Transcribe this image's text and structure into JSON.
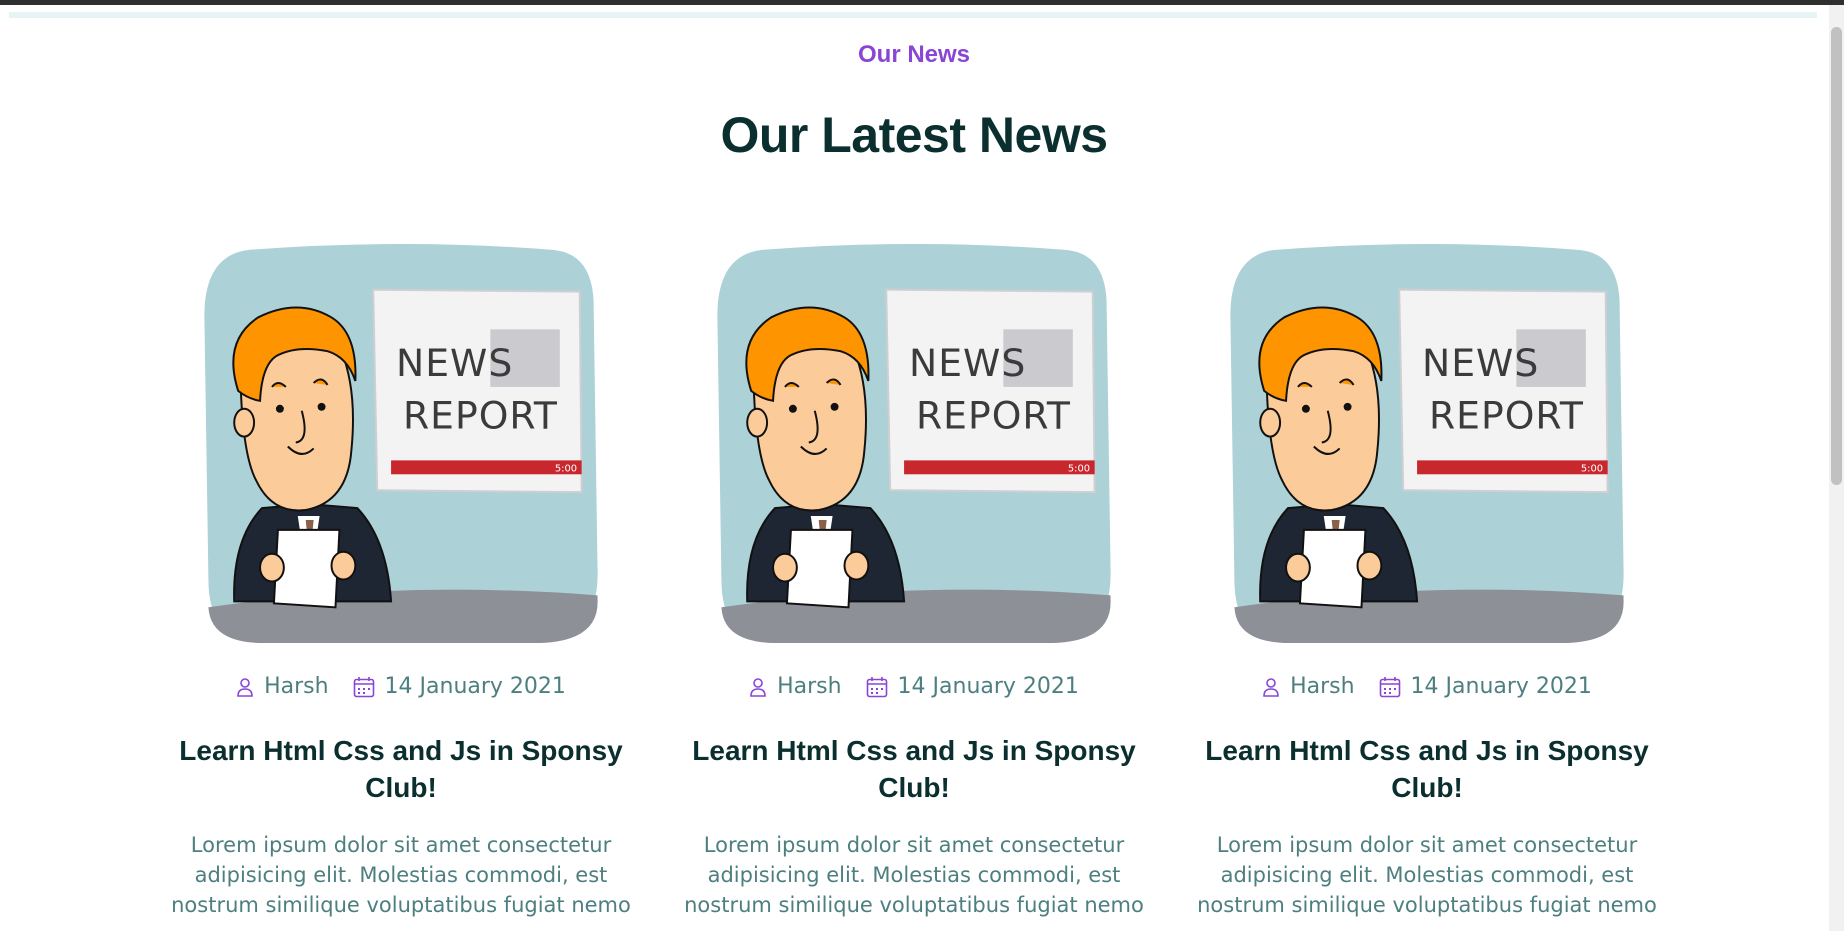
{
  "section": {
    "eyebrow": "Our News",
    "title": "Our Latest News"
  },
  "colors": {
    "accent": "#8a45d6",
    "heading": "#0b2f2f",
    "body_text": "#4e7f80"
  },
  "cards": [
    {
      "image_label_line1": "NEWS",
      "image_label_line2": "REPORT",
      "image_time": "5:00",
      "author": "Harsh",
      "date": "14 January 2021",
      "title": "Learn Html Css and Js in Sponsy Club!",
      "excerpt": "Lorem ipsum dolor sit amet consectetur adipisicing elit. Molestias commodi, est nostrum similique voluptatibus fugiat nemo"
    },
    {
      "image_label_line1": "NEWS",
      "image_label_line2": "REPORT",
      "image_time": "5:00",
      "author": "Harsh",
      "date": "14 January 2021",
      "title": "Learn Html Css and Js in Sponsy Club!",
      "excerpt": "Lorem ipsum dolor sit amet consectetur adipisicing elit. Molestias commodi, est nostrum similique voluptatibus fugiat nemo"
    },
    {
      "image_label_line1": "NEWS",
      "image_label_line2": "REPORT",
      "image_time": "5:00",
      "author": "Harsh",
      "date": "14 January 2021",
      "title": "Learn Html Css and Js in Sponsy Club!",
      "excerpt": "Lorem ipsum dolor sit amet consectetur adipisicing elit. Molestias commodi, est nostrum similique voluptatibus fugiat nemo"
    }
  ],
  "icons": {
    "author": "user-icon",
    "date": "calendar-icon"
  }
}
